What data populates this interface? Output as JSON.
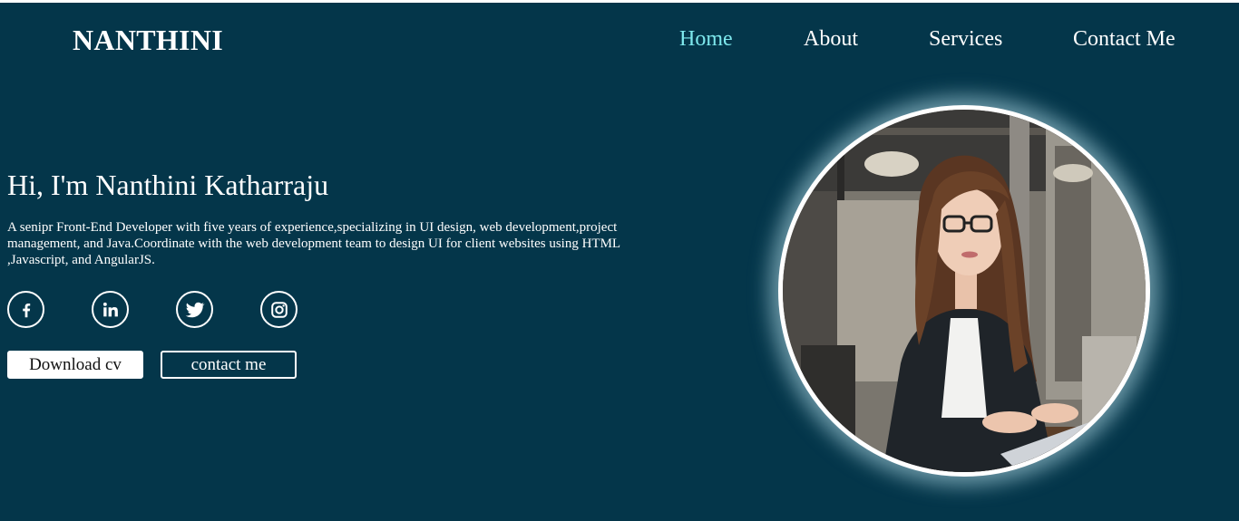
{
  "brand": {
    "logo": "NANTHINI"
  },
  "nav": {
    "items": [
      {
        "label": "Home",
        "active": true
      },
      {
        "label": "About",
        "active": false
      },
      {
        "label": "Services",
        "active": false
      },
      {
        "label": "Contact Me",
        "active": false
      }
    ]
  },
  "hero": {
    "title": "Hi, I'm Nanthini Katharraju",
    "description": "A senipr Front-End Developer with five years of experience,specializing in UI design, web development,project management, and Java.Coordinate with the web development team to design UI for client websites using HTML ,Javascript, and AngularJS.",
    "socials": [
      {
        "icon": "facebook-icon"
      },
      {
        "icon": "linkedin-icon"
      },
      {
        "icon": "twitter-icon"
      },
      {
        "icon": "instagram-icon"
      }
    ],
    "buttons": {
      "download": "Download cv",
      "contact": "contact me"
    }
  },
  "profile_image": {
    "subject": "profile-photo"
  },
  "colors": {
    "background": "#04364a",
    "accent": "#7ee8ed",
    "text": "#ffffff"
  }
}
